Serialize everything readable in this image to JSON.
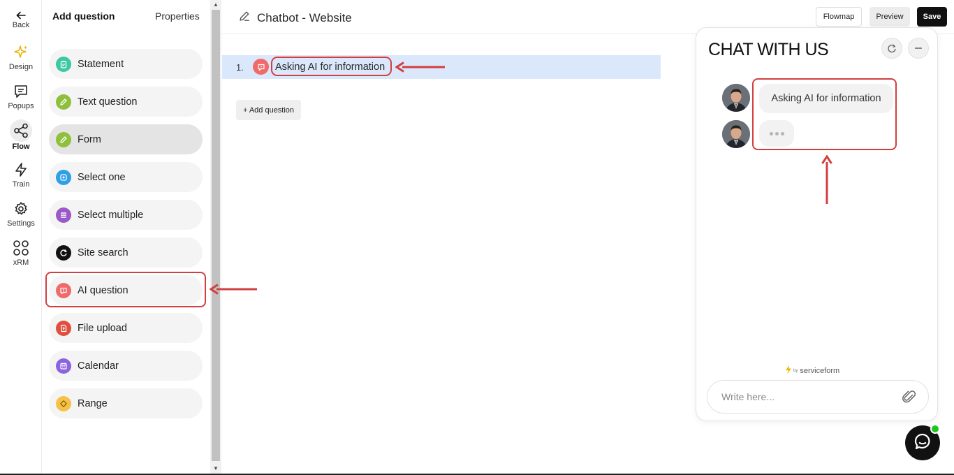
{
  "rail": {
    "back": "Back",
    "items": [
      {
        "label": "Design",
        "icon": "sparkle-icon"
      },
      {
        "label": "Popups",
        "icon": "message-square-icon"
      },
      {
        "label": "Flow",
        "icon": "share-nodes-icon"
      },
      {
        "label": "Train",
        "icon": "lightning-icon"
      },
      {
        "label": "Settings",
        "icon": "gear-icon"
      },
      {
        "label": "xRM",
        "icon": "grid-icon"
      }
    ],
    "active": "Flow"
  },
  "panel": {
    "tab_add": "Add question",
    "tab_properties": "Properties",
    "items": [
      {
        "label": "Statement",
        "icon": "clipboard-icon",
        "color": "#3cc8a0"
      },
      {
        "label": "Text question",
        "icon": "pencil-icon",
        "color": "#8ec03c"
      },
      {
        "label": "Form",
        "icon": "pencil-icon",
        "color": "#8ec03c"
      },
      {
        "label": "Select one",
        "icon": "select-icon",
        "color": "#2f9fe6"
      },
      {
        "label": "Select multiple",
        "icon": "list-icon",
        "color": "#9b59c8"
      },
      {
        "label": "Site search",
        "icon": "refresh-icon",
        "color": "#111111"
      },
      {
        "label": "AI question",
        "icon": "ai-bubble-icon",
        "color": "#f06a6a"
      },
      {
        "label": "File upload",
        "icon": "file-upload-icon",
        "color": "#e0503f"
      },
      {
        "label": "Calendar",
        "icon": "calendar-icon",
        "color": "#8b62e0"
      },
      {
        "label": "Range",
        "icon": "diamond-icon",
        "color": "#f5c147"
      }
    ],
    "selected": "Form",
    "highlighted": "AI question"
  },
  "topbar": {
    "title": "Chatbot - Website",
    "flowmap": "Flowmap",
    "preview": "Preview",
    "save": "Save"
  },
  "flow": {
    "questions": [
      {
        "number": "1.",
        "label": "Asking AI for information"
      }
    ],
    "add_question": "+ Add question"
  },
  "chat": {
    "title": "CHAT WITH US",
    "message": "Asking AI for information",
    "powered_by": "by",
    "brand": "serviceform",
    "input_placeholder": "Write here..."
  },
  "colors": {
    "highlight": "#d23f3f",
    "selected_row": "#dbe8fb",
    "online": "#1ec51e"
  }
}
